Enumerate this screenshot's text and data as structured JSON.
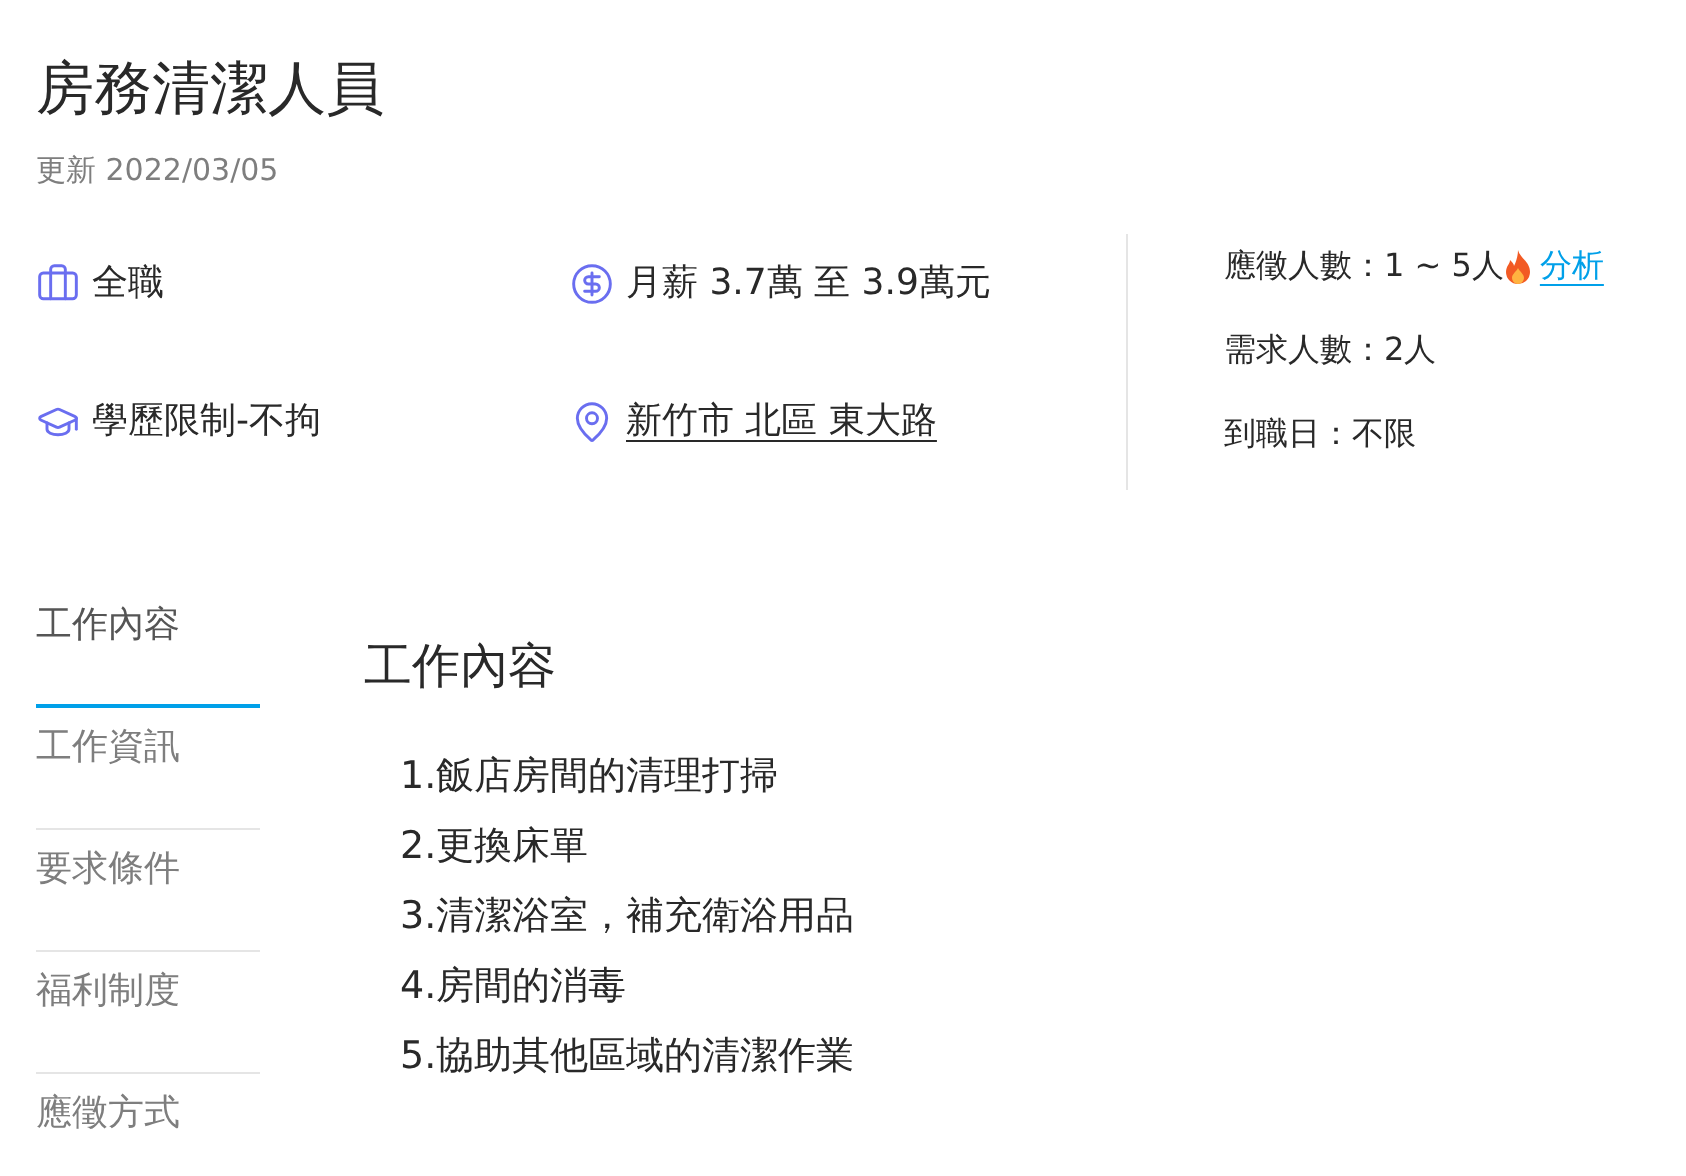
{
  "title": "房務清潔人員",
  "updated": "更新 2022/03/05",
  "info": [
    {
      "kind": "job_type",
      "text": "全職"
    },
    {
      "kind": "salary",
      "text": "月薪 3.7萬 至 3.9萬元"
    },
    {
      "kind": "education",
      "text": "學歷限制-不拘"
    },
    {
      "kind": "location",
      "text": "新竹市 北區 東大路"
    }
  ],
  "stats": {
    "applicants": "應徵人數：1 ~ 5人",
    "analysis_link": "分析",
    "needed": "需求人數：2人",
    "start_date": "到職日：不限"
  },
  "nav": [
    {
      "label": "工作內容",
      "selected": true
    },
    {
      "label": "工作資訊",
      "selected": false
    },
    {
      "label": "要求條件",
      "selected": false
    },
    {
      "label": "福利制度",
      "selected": false
    },
    {
      "label": "應徵方式",
      "selected": false
    }
  ],
  "section": {
    "heading": "工作內容",
    "items": [
      "1.飯店房間的清理打掃",
      "2.更換床單",
      "3.清潔浴室，補充衛浴用品",
      "4.房間的消毒",
      "5.協助其他區域的清潔作業"
    ]
  }
}
